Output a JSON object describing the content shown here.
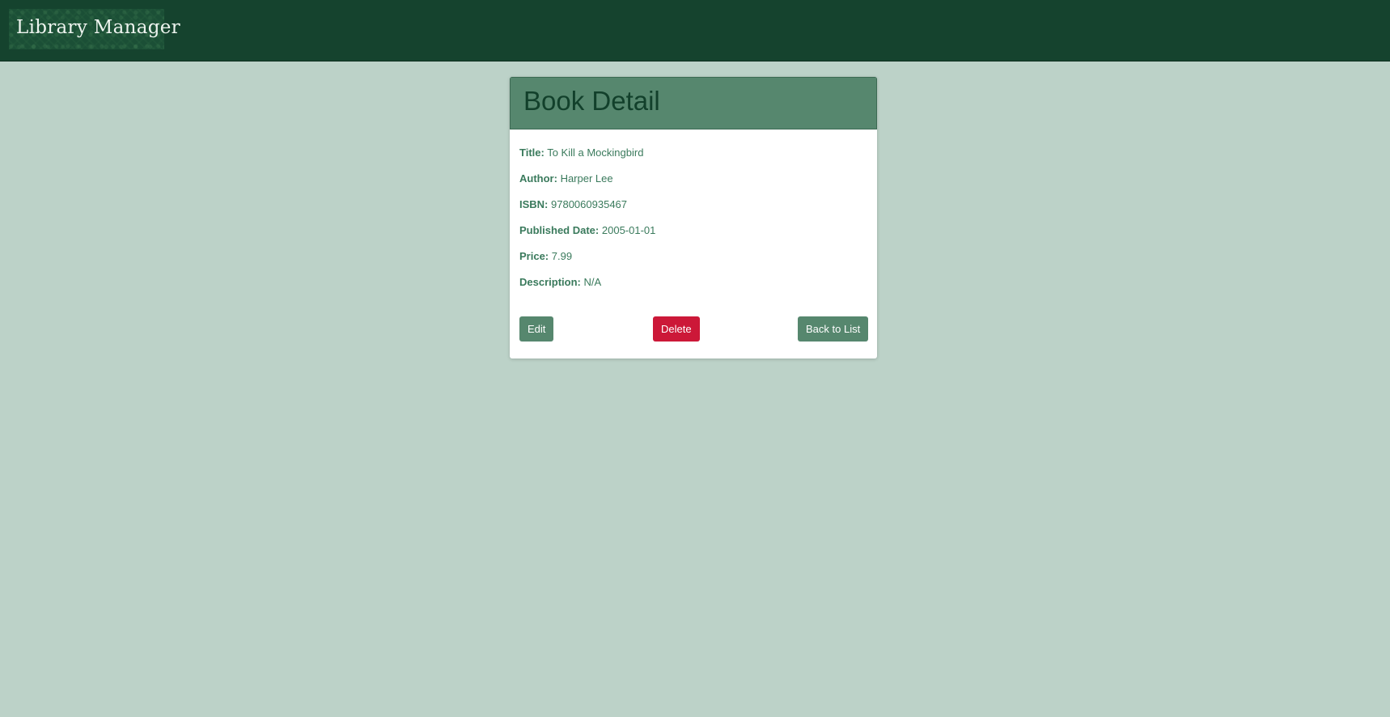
{
  "app": {
    "title": "Library Manager"
  },
  "card": {
    "title": "Book Detail",
    "fields": [
      {
        "label": "Title:",
        "value": "To Kill a Mockingbird"
      },
      {
        "label": "Author:",
        "value": "Harper Lee"
      },
      {
        "label": "ISBN:",
        "value": "9780060935467"
      },
      {
        "label": "Published Date:",
        "value": "2005-01-01"
      },
      {
        "label": "Price:",
        "value": "7.99"
      },
      {
        "label": "Description:",
        "value": "N/A"
      }
    ],
    "buttons": {
      "edit": "Edit",
      "delete": "Delete",
      "back": "Back to List"
    }
  },
  "colors": {
    "background": "#bcd2c8",
    "topbar": "#15432e",
    "header": "#56876e",
    "primary_button": "#56876e",
    "danger_button": "#cc1838",
    "text": "#3a7a5c"
  }
}
